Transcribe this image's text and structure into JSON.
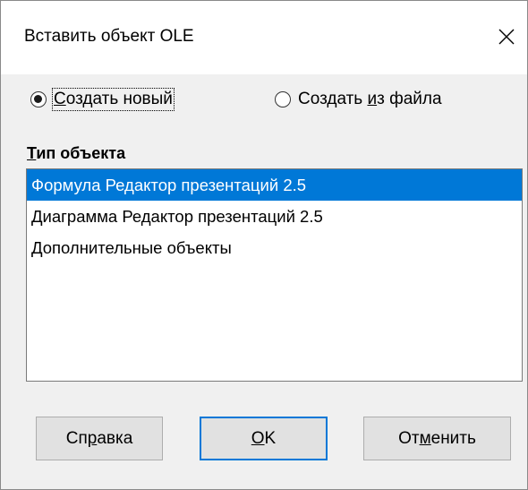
{
  "dialog": {
    "title": "Вставить объект OLE",
    "close_icon": "close-icon"
  },
  "options": {
    "create_new": {
      "label_underlined": "С",
      "label_rest": "оздать новый",
      "checked": true
    },
    "create_from_file": {
      "label_before": "Создать ",
      "label_underlined": "и",
      "label_after": "з файла",
      "checked": false
    }
  },
  "object_type": {
    "label_underlined": "Т",
    "label_rest": "ип объекта",
    "items": [
      "Формула Редактор презентаций 2.5",
      "Диаграмма Редактор презентаций 2.5",
      "Дополнительные объекты"
    ],
    "selected_index": 0
  },
  "buttons": {
    "help": {
      "label_before": "Сп",
      "label_underlined": "р",
      "label_after": "авка"
    },
    "ok": {
      "label_underlined": "O",
      "label_after": "K"
    },
    "cancel": {
      "label_before": "От",
      "label_underlined": "м",
      "label_after": "енить"
    }
  },
  "colors": {
    "selection": "#0078d7",
    "default_button_border": "#0078d7"
  }
}
